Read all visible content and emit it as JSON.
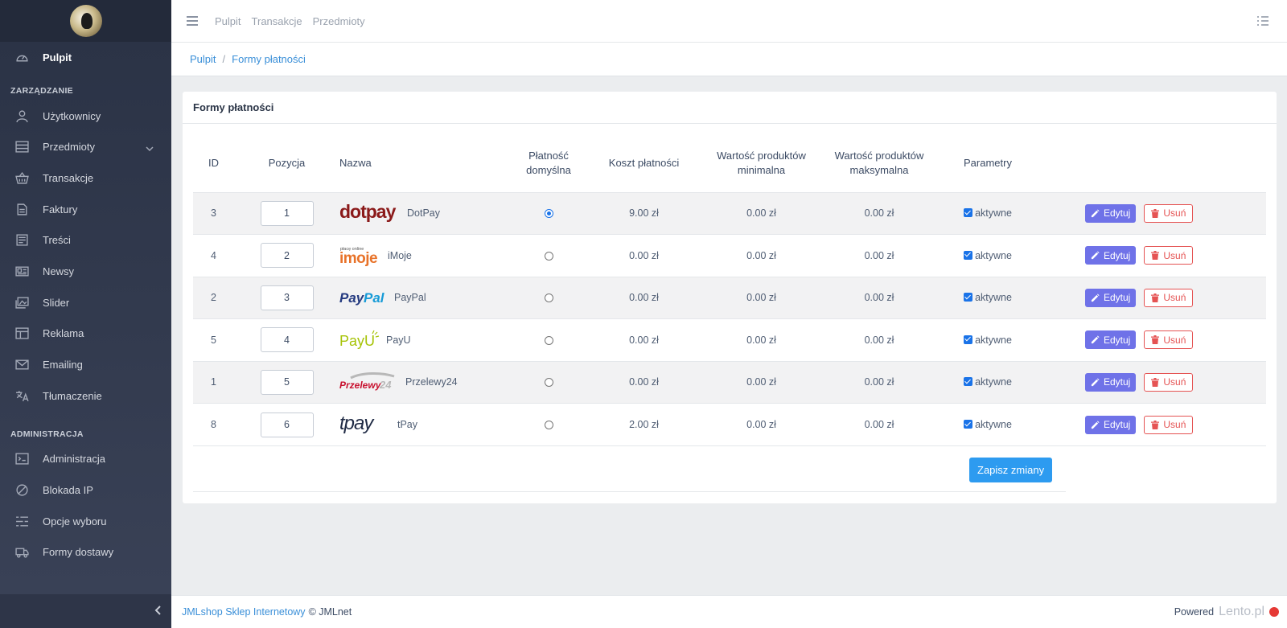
{
  "sidebar": {
    "logo_icon": "penguin-logo",
    "items_top": [
      {
        "label": "Pulpit",
        "icon": "speedometer-icon"
      }
    ],
    "section_management": "ZARZĄDZANIE",
    "items_management": [
      {
        "label": "Użytkownicy",
        "icon": "user-icon"
      },
      {
        "label": "Przedmioty",
        "icon": "list-icon"
      },
      {
        "label": "Transakcje",
        "icon": "basket-icon"
      },
      {
        "label": "Faktury",
        "icon": "file-icon"
      },
      {
        "label": "Treści",
        "icon": "notes-icon"
      },
      {
        "label": "Newsy",
        "icon": "newspaper-icon"
      },
      {
        "label": "Slider",
        "icon": "images-icon"
      },
      {
        "label": "Reklama",
        "icon": "layout-icon"
      },
      {
        "label": "Emailing",
        "icon": "envelope-icon"
      },
      {
        "label": "Tłumaczenie",
        "icon": "language-icon"
      }
    ],
    "section_admin": "ADMINISTRACJA",
    "items_admin": [
      {
        "label": "Administracja",
        "icon": "terminal-icon"
      },
      {
        "label": "Blokada IP",
        "icon": "ban-icon"
      },
      {
        "label": "Opcje wyboru",
        "icon": "options-icon"
      },
      {
        "label": "Formy dostawy",
        "icon": "truck-icon"
      }
    ]
  },
  "header": {
    "links": [
      "Pulpit",
      "Transakcje",
      "Przedmioty"
    ]
  },
  "breadcrumb": {
    "home": "Pulpit",
    "current": "Formy płatności"
  },
  "card": {
    "title": "Formy płatności",
    "columns": {
      "id": "ID",
      "position": "Pozycja",
      "name": "Nazwa",
      "default_1": "Płatność",
      "default_2": "domyślna",
      "cost": "Koszt płatności",
      "min_1": "Wartość produktów",
      "min_2": "minimalna",
      "max_1": "Wartość produktów",
      "max_2": "maksymalna",
      "params": "Parametry"
    },
    "rows": [
      {
        "id": "3",
        "position": "1",
        "name": "DotPay",
        "default": true,
        "cost": "9.00 zł",
        "min": "0.00 zł",
        "max": "0.00 zł",
        "param": "aktywne",
        "edit": "Edytuj",
        "delete": "Usuń"
      },
      {
        "id": "4",
        "position": "2",
        "name": "iMoje",
        "default": false,
        "cost": "0.00 zł",
        "min": "0.00 zł",
        "max": "0.00 zł",
        "param": "aktywne",
        "edit": "Edytuj",
        "delete": "Usuń"
      },
      {
        "id": "2",
        "position": "3",
        "name": "PayPal",
        "default": false,
        "cost": "0.00 zł",
        "min": "0.00 zł",
        "max": "0.00 zł",
        "param": "aktywne",
        "edit": "Edytuj",
        "delete": "Usuń"
      },
      {
        "id": "5",
        "position": "4",
        "name": "PayU",
        "default": false,
        "cost": "0.00 zł",
        "min": "0.00 zł",
        "max": "0.00 zł",
        "param": "aktywne",
        "edit": "Edytuj",
        "delete": "Usuń"
      },
      {
        "id": "1",
        "position": "5",
        "name": "Przelewy24",
        "default": false,
        "cost": "0.00 zł",
        "min": "0.00 zł",
        "max": "0.00 zł",
        "param": "aktywne",
        "edit": "Edytuj",
        "delete": "Usuń"
      },
      {
        "id": "8",
        "position": "6",
        "name": "tPay",
        "default": false,
        "cost": "2.00 zł",
        "min": "0.00 zł",
        "max": "0.00 zł",
        "param": "aktywne",
        "edit": "Edytuj",
        "delete": "Usuń"
      }
    ],
    "logos": {
      "dotpay": "dotpay",
      "imoje_top": "płacę online",
      "imoje": "imoje",
      "paypal_a": "Pay",
      "paypal_b": "Pal",
      "payu": "PayU",
      "p24_a": "Przelewy",
      "p24_b": "24",
      "tpay": "tpay"
    },
    "save_label": "Zapisz zmiany"
  },
  "footer": {
    "link": "JMLshop Sklep Internetowy",
    "copyright": "© JMLnet",
    "powered": "Powered",
    "watermark": "Lento.pl"
  },
  "colors": {
    "sidebar_bg": "#2a3245",
    "link": "#3a8fd8",
    "edit_button": "#6f72e8",
    "delete_button": "#e55353",
    "save_button": "#2d9bf0"
  }
}
